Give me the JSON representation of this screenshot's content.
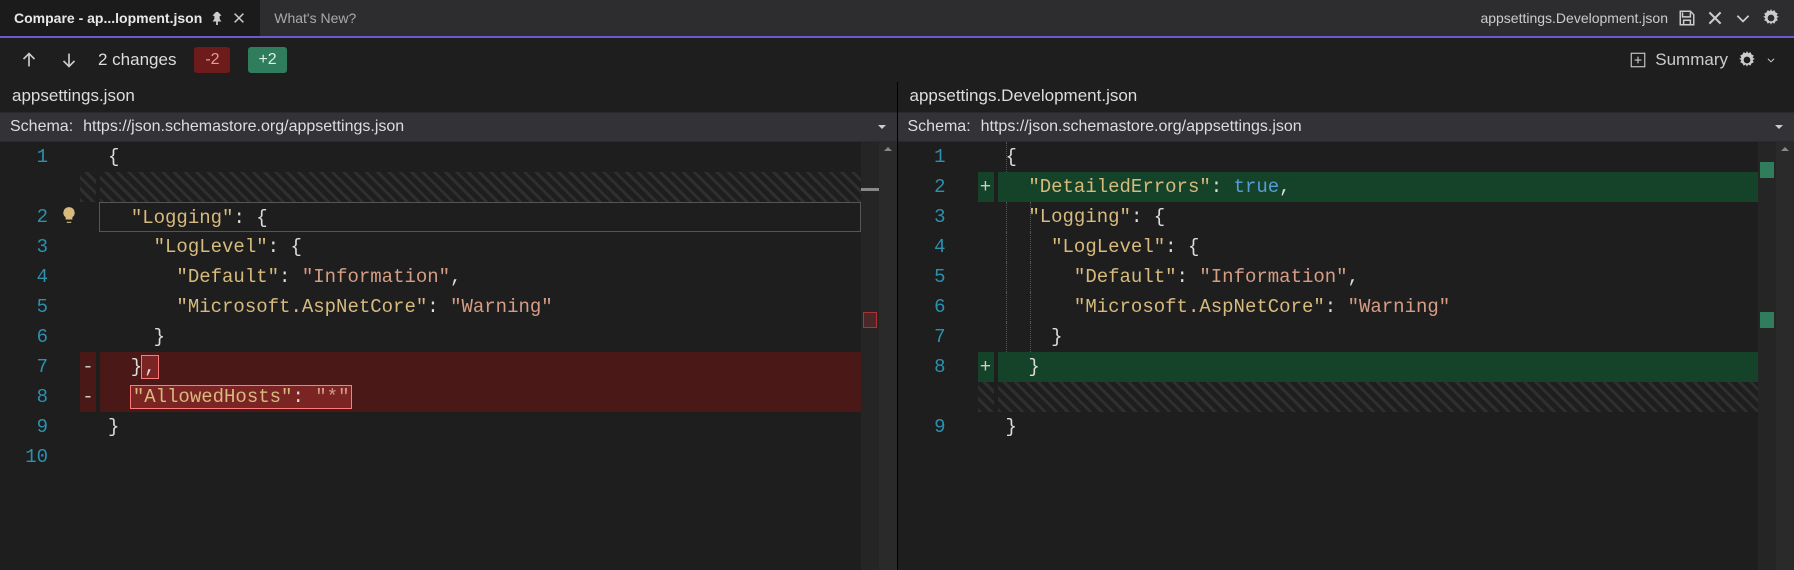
{
  "tabs": {
    "active": {
      "label": "Compare - ap...lopment.json"
    },
    "inactive": {
      "label": "What's New?"
    }
  },
  "header_right": {
    "filename": "appsettings.Development.json"
  },
  "toolbar": {
    "changes": "2 changes",
    "minus_badge": "-2",
    "plus_badge": "+2",
    "summary": "Summary"
  },
  "left_pane": {
    "title": "appsettings.json",
    "schema_label": "Schema:",
    "schema_value": "https://json.schemastore.org/appsettings.json",
    "lines": {
      "l1": "1",
      "l2": "2",
      "l3": "3",
      "l4": "4",
      "l5": "5",
      "l6": "6",
      "l7": "7",
      "l8": "8",
      "l9": "9",
      "l10": "10"
    },
    "code": {
      "logging_key": "\"Logging\"",
      "loglevel_key": "\"LogLevel\"",
      "default_key": "\"Default\"",
      "default_val": "\"Information\"",
      "aspnet_key": "\"Microsoft.AspNetCore\"",
      "aspnet_val": "\"Warning\"",
      "allowed_key": "\"AllowedHosts\"",
      "allowed_val": "\"*\""
    }
  },
  "right_pane": {
    "title": "appsettings.Development.json",
    "schema_label": "Schema:",
    "schema_value": "https://json.schemastore.org/appsettings.json",
    "lines": {
      "l1": "1",
      "l2": "2",
      "l3": "3",
      "l4": "4",
      "l5": "5",
      "l6": "6",
      "l7": "7",
      "l8": "8",
      "l9": "9"
    },
    "code": {
      "detailed_key": "\"DetailedErrors\"",
      "detailed_val": "true",
      "logging_key": "\"Logging\"",
      "loglevel_key": "\"LogLevel\"",
      "default_key": "\"Default\"",
      "default_val": "\"Information\"",
      "aspnet_key": "\"Microsoft.AspNetCore\"",
      "aspnet_val": "\"Warning\""
    }
  },
  "glue": {
    "colon_brace": ": {",
    "colon_sp": ": ",
    "comma": ",",
    "open_brace": "{",
    "close_brace": "}",
    "close_brace_comma": "},",
    "brace_only": "}",
    "closebrace_hl": ","
  }
}
